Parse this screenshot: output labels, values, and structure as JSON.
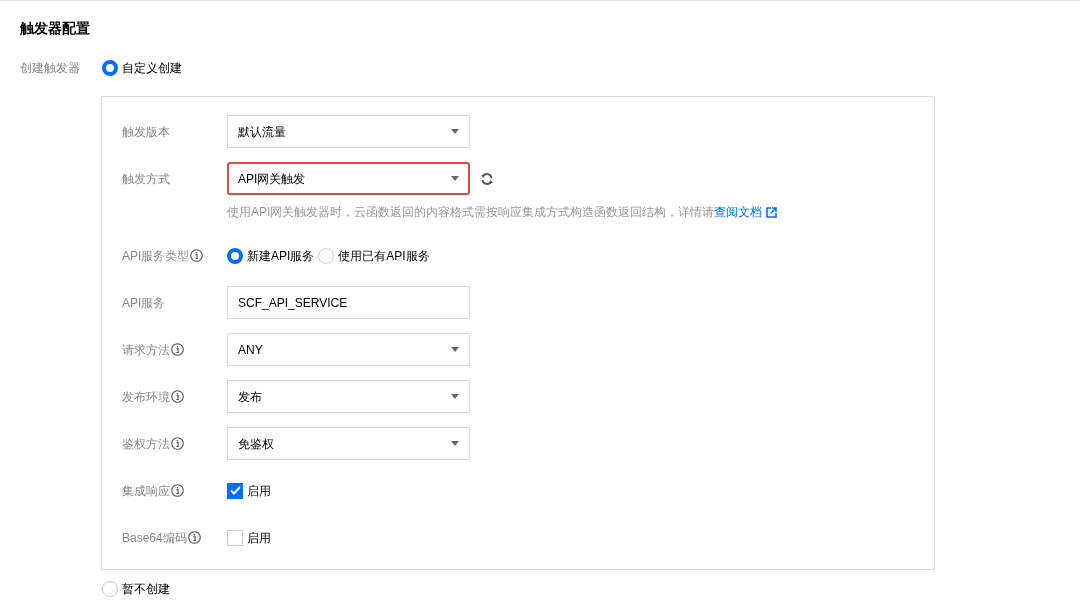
{
  "title": "触发器配置",
  "create_trigger": {
    "label": "创建触发器",
    "options": [
      {
        "label": "自定义创建",
        "selected": true
      },
      {
        "label": "暂不创建",
        "selected": false
      }
    ]
  },
  "fields": [
    {
      "kind": "select",
      "label": "触发版本",
      "info": false,
      "value": "默认流量",
      "highlighted": false
    },
    {
      "kind": "select",
      "label": "触发方式",
      "info": false,
      "value": "API网关触发",
      "highlighted": true,
      "refresh": true,
      "hint": {
        "text": "使用API网关触发器时，云函数返回的内容格式需按响应集成方式构造函数返回结构，详情请",
        "link": "查阅文档"
      }
    },
    {
      "kind": "radio",
      "label": "API服务类型",
      "info": true,
      "options": [
        {
          "label": "新建API服务",
          "selected": true
        },
        {
          "label": "使用已有API服务",
          "selected": false
        }
      ]
    },
    {
      "kind": "input",
      "label": "API服务",
      "info": false,
      "value": "SCF_API_SERVICE"
    },
    {
      "kind": "select",
      "label": "请求方法",
      "info": true,
      "value": "ANY",
      "highlighted": false
    },
    {
      "kind": "select",
      "label": "发布环境",
      "info": true,
      "value": "发布",
      "highlighted": false
    },
    {
      "kind": "select",
      "label": "鉴权方法",
      "info": true,
      "value": "免鉴权",
      "highlighted": false
    },
    {
      "kind": "checkbox",
      "label": "集成响应",
      "info": true,
      "option": "启用",
      "checked": true
    },
    {
      "kind": "checkbox",
      "label": "Base64编码",
      "info": true,
      "option": "启用",
      "checked": false
    }
  ]
}
